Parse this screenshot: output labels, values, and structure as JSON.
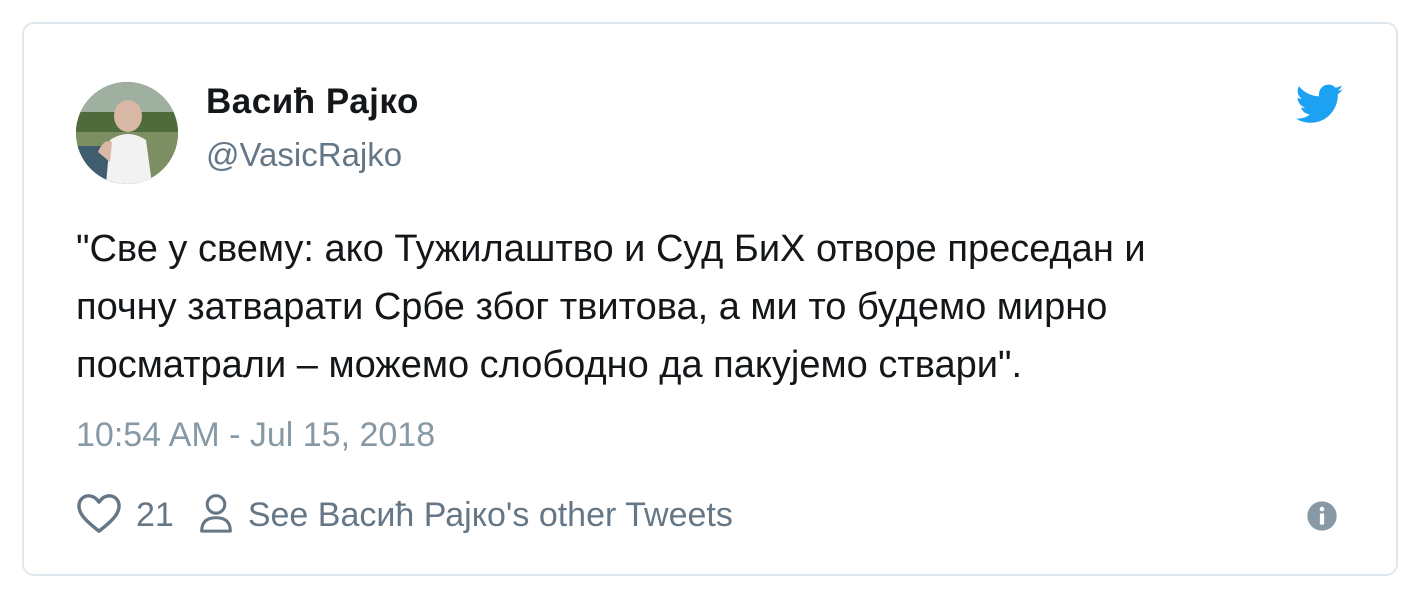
{
  "author": {
    "display_name": "Васић Рајко",
    "handle": "@VasicRajko"
  },
  "tweet": {
    "text_lines": [
      "\"Све у свему: ако Тужилаштво и Суд БиХ отворе преседан и",
      "почну затварати Србе због твитова, а ми то будемо мирно",
      "посматрали – можемо слободно да пакујемо ствари\"."
    ],
    "timestamp": "10:54 AM - Jul 15, 2018"
  },
  "actions": {
    "like_count": "21",
    "profile_link_label": "See Васић Рајко's other Tweets"
  },
  "icons": {
    "brand": "twitter-bird-icon",
    "like": "heart-icon",
    "profile": "person-icon",
    "info": "info-icon"
  },
  "colors": {
    "twitter_blue": "#1da1f2",
    "text_primary": "#14171a",
    "text_secondary": "#657786",
    "timestamp": "#8899a6",
    "border": "#e1e8ed"
  }
}
